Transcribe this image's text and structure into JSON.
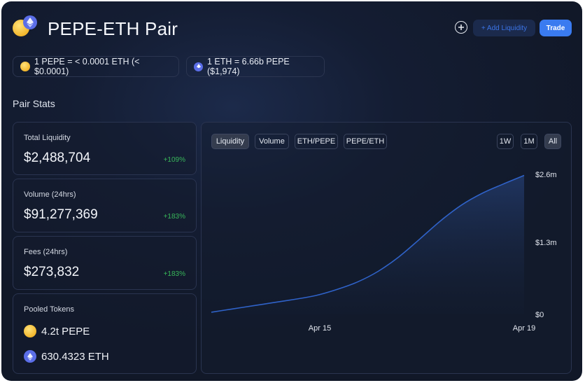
{
  "header": {
    "title": "PEPE-ETH Pair",
    "add_liquidity_label": "+ Add Liquidity",
    "trade_label": "Trade",
    "icons": [
      "pepe-token-icon",
      "eth-token-icon",
      "plus-circle-icon"
    ]
  },
  "prices": {
    "pepe_to_eth": "1 PEPE = < 0.0001 ETH (< $0.0001)",
    "eth_to_pepe": "1 ETH = 6.66b PEPE ($1,974)"
  },
  "stats": {
    "section_title": "Pair Stats",
    "total_liquidity": {
      "label": "Total Liquidity",
      "value": "$2,488,704",
      "change": "+109%"
    },
    "volume": {
      "label": "Volume (24hrs)",
      "value": "$91,277,369",
      "change": "+183%"
    },
    "fees": {
      "label": "Fees (24hrs)",
      "value": "$273,832",
      "change": "+183%"
    },
    "pooled": {
      "label": "Pooled Tokens",
      "pepe": "4.2t PEPE",
      "eth": "630.4323 ETH"
    }
  },
  "chart_tabs": {
    "metrics": [
      "Liquidity",
      "Volume",
      "ETH/PEPE",
      "PEPE/ETH"
    ],
    "active_metric": "Liquidity",
    "ranges": [
      "1W",
      "1M",
      "All"
    ],
    "active_range": "All"
  },
  "colors": {
    "accent": "#3a7bf0",
    "positive": "#38b75a",
    "line": "#2f62c8"
  },
  "chart_data": {
    "type": "area",
    "series": [
      {
        "values": [
          0.04,
          0.1,
          0.16,
          0.22,
          0.28,
          0.35,
          0.46,
          0.6,
          0.8,
          1.07,
          1.4,
          1.74,
          2.03,
          2.25,
          2.42,
          2.58
        ]
      }
    ],
    "x_tick_labels": [
      "Apr 15",
      "Apr 19"
    ],
    "y_tick_labels": [
      "$2.6m",
      "$1.3m",
      "$0"
    ],
    "ylim": [
      0,
      2.6
    ],
    "grid": false,
    "y_axis_side": "right"
  }
}
